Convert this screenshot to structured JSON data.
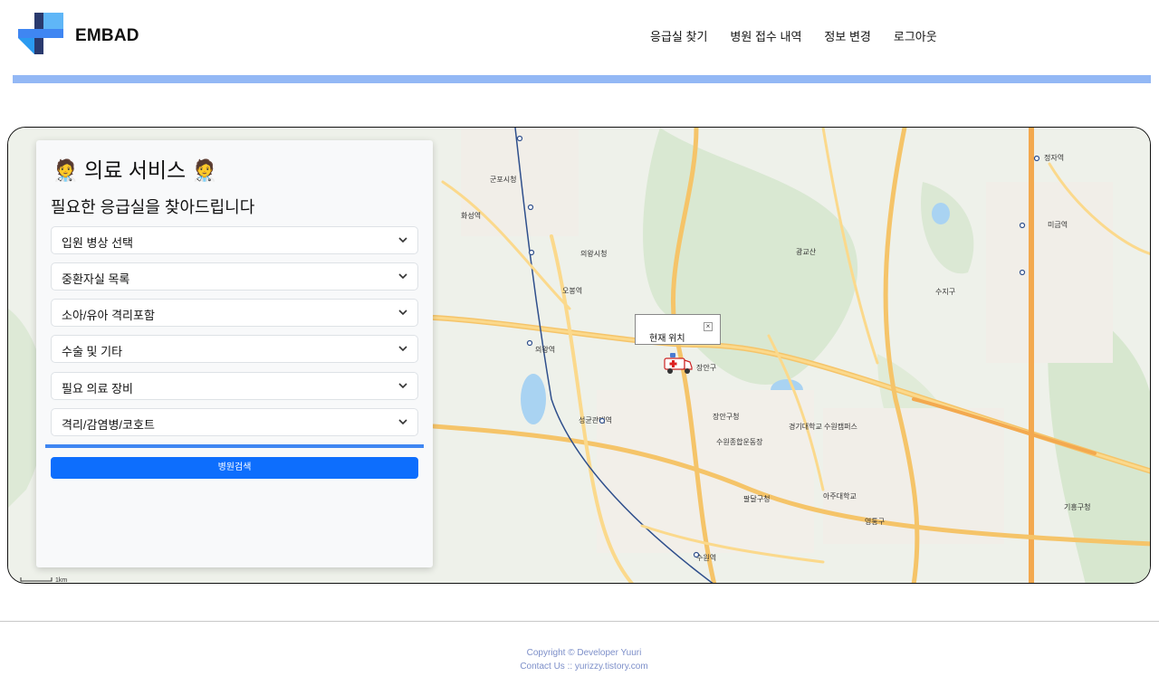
{
  "header": {
    "brand": "EMBAD",
    "nav": [
      "응급실 찾기",
      "병원 접수 내역",
      "정보 변경",
      "로그아웃"
    ]
  },
  "panel": {
    "title": "의료 서비스",
    "title_emoji": "🧑‍⚕️",
    "subtitle": "필요한 응급실을 찾아드립니다",
    "selects": [
      "입원 병상 선택",
      "중환자실 목록",
      "소아/유아 격리포함",
      "수술 및 기타",
      "필요 의료 장비",
      "격리/감염병/코호트"
    ],
    "search_label": "병원검색"
  },
  "map": {
    "popup_text": "현재 위치",
    "popup_close": "×",
    "scale_label": "1km",
    "labels": [
      "군포시청",
      "의왕시청",
      "오봉역",
      "의왕역",
      "장안구",
      "장안구청",
      "수원역",
      "팔달구청",
      "영통구",
      "기흥구청",
      "수지구",
      "정자역",
      "미금역",
      "광교산",
      "화성역",
      "성균관대역",
      "수원종합운동장",
      "경기대학교 수원캠퍼스",
      "아주대학교"
    ]
  },
  "footer": {
    "copyright": "Copyright © Developer Yuuri",
    "contact": "Contact Us :: yurizzy.tistory.com"
  },
  "colors": {
    "accent": "#0d6efd",
    "bar": "#93b8f5",
    "footer_text": "#7d8fc9"
  }
}
